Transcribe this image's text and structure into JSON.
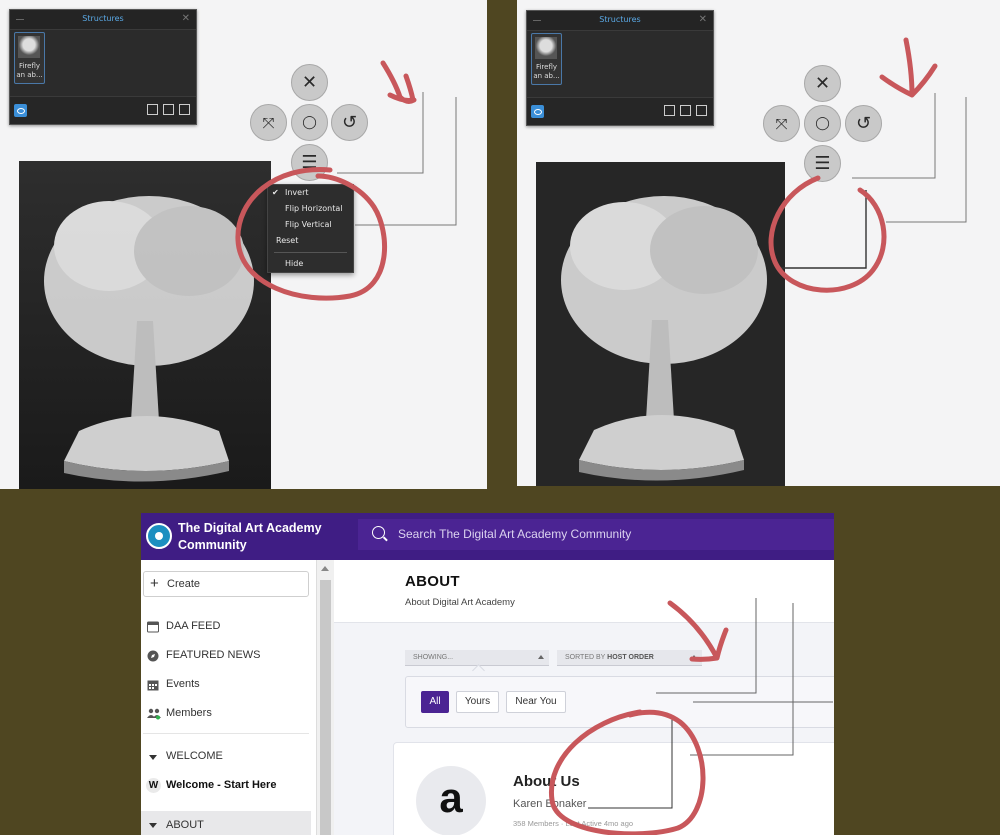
{
  "structures_panel": {
    "title": "Structures",
    "thumb_caption": "Firefly an ab..."
  },
  "context_menu": {
    "items": [
      {
        "label": "Invert",
        "checked": true
      },
      {
        "label": "Flip Horizontal"
      },
      {
        "label": "Flip Vertical"
      },
      {
        "label": "Reset"
      },
      {
        "label": "Hide"
      }
    ]
  },
  "round_buttons": [
    "close-icon",
    "fit-icon",
    "center-icon",
    "reset-rotation-icon",
    "menu-icon"
  ],
  "colors": {
    "annotation_red": "#c8575b",
    "app_purple": "#3f1d84",
    "search_purple": "#4b2493"
  },
  "community": {
    "site_name_line1": "The Digital Art Academy",
    "site_name_line2": "Community",
    "search_placeholder": "Search The Digital Art Academy Community",
    "sidebar": {
      "create_label": "Create",
      "nav": [
        {
          "label": "DAA FEED",
          "icon": "feed-icon"
        },
        {
          "label": "FEATURED NEWS",
          "icon": "compass-icon"
        },
        {
          "label": "Events",
          "icon": "calendar-icon"
        },
        {
          "label": "Members",
          "icon": "members-icon"
        }
      ],
      "section_welcome": "WELCOME",
      "welcome_item": "Welcome - Start Here",
      "welcome_badge": "W",
      "section_about": "ABOUT"
    },
    "main": {
      "title": "ABOUT",
      "subtitle": "About Digital Art Academy",
      "showing_label": "SHOWING...",
      "sorted_prefix": "SORTED BY",
      "sorted_value": "HOST ORDER",
      "filters": [
        "All",
        "Yours",
        "Near You"
      ],
      "active_filter": "All",
      "card": {
        "avatar_letter": "a",
        "title": "About Us",
        "owner": "Karen Bonaker",
        "meta": "358 Members · Last Active 4mo ago"
      }
    }
  }
}
